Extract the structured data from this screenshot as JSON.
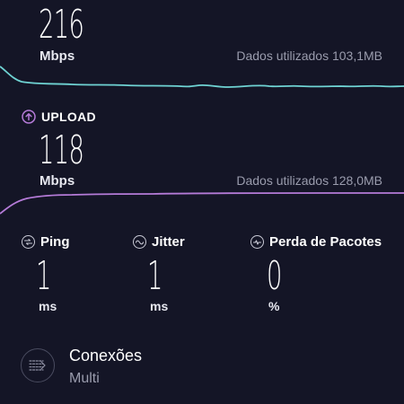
{
  "download": {
    "value": "216",
    "unit": "Mbps",
    "data_used": "Dados utilizados 103,1MB",
    "graph_color": "#6fd3d3"
  },
  "upload": {
    "label": "UPLOAD",
    "icon": "arrow-up-circle-icon",
    "value": "118",
    "unit": "Mbps",
    "data_used": "Dados utilizados 128,0MB",
    "accent_color": "#b57bd8",
    "graph_color": "#b57bd8"
  },
  "metrics": [
    {
      "label": "Ping",
      "icon": "ping-icon",
      "value": "1",
      "unit": "ms"
    },
    {
      "label": "Jitter",
      "icon": "jitter-icon",
      "value": "1",
      "unit": "ms"
    },
    {
      "label": "Perda de Pacotes",
      "icon": "packet-loss-icon",
      "value": "0",
      "unit": "%"
    }
  ],
  "connections": {
    "icon": "connections-icon",
    "title": "Conexões",
    "value": "Multi"
  }
}
